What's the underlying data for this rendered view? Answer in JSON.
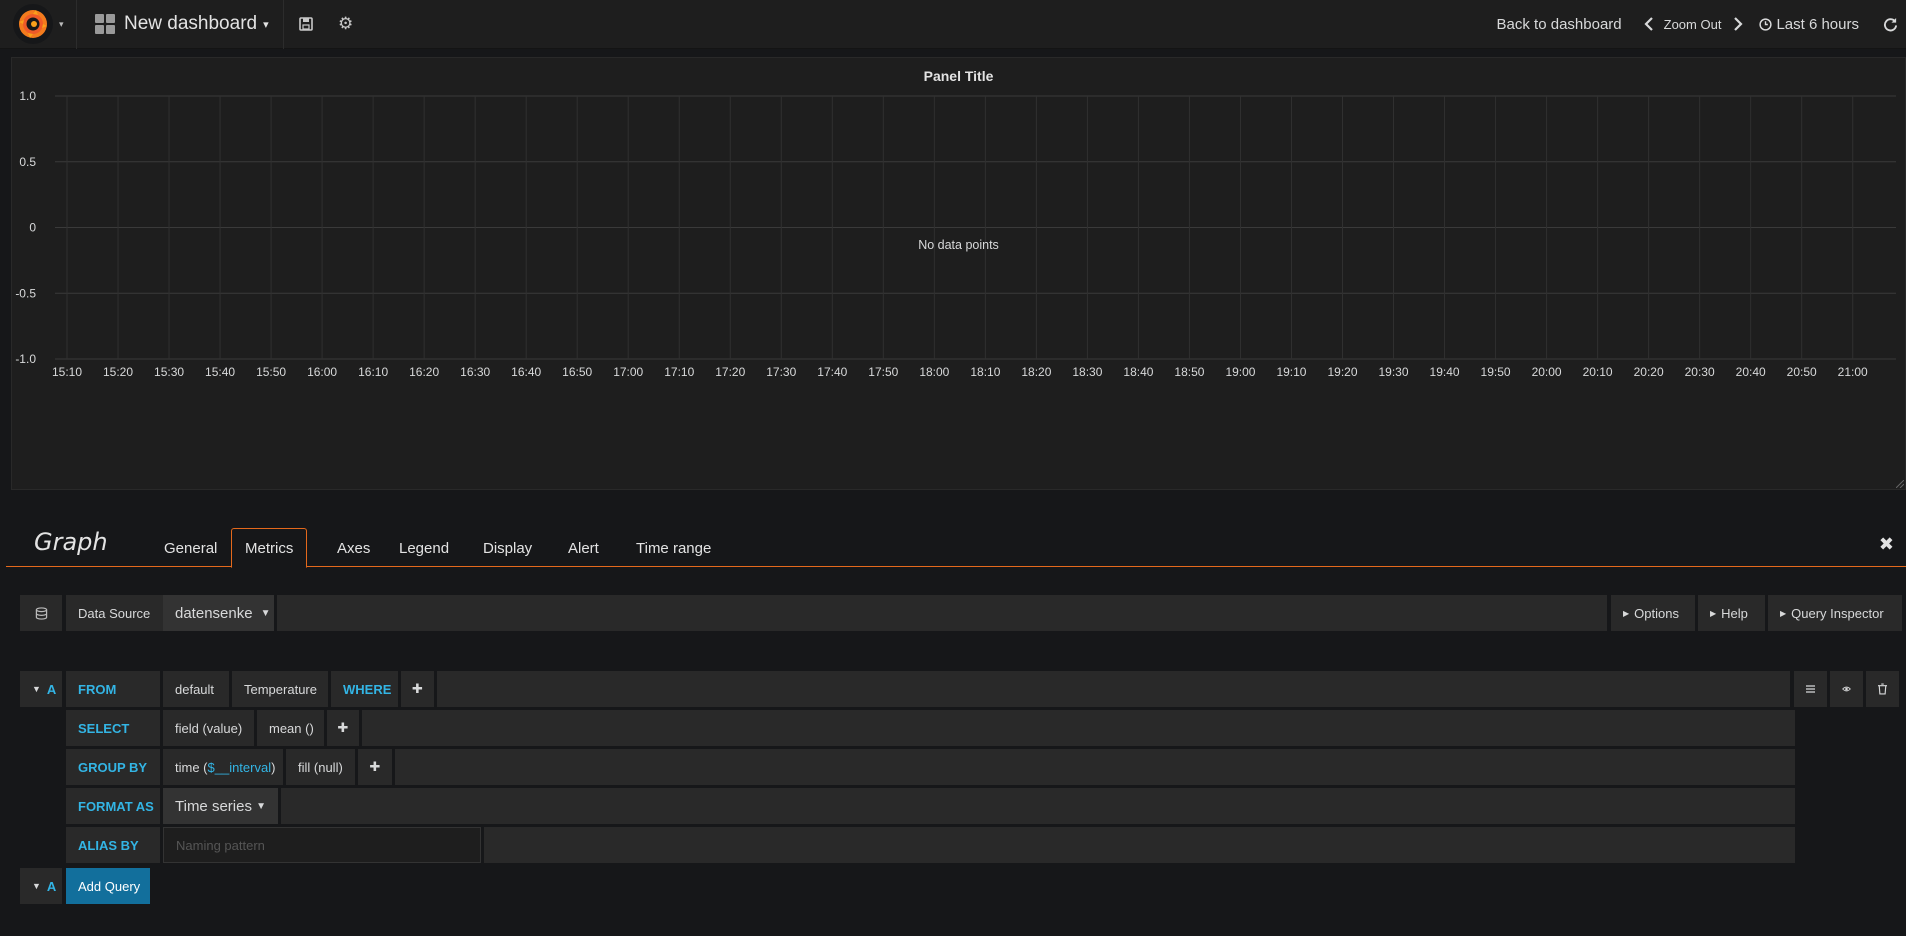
{
  "navbar": {
    "dashboard_title": "New dashboard",
    "back_label": "Back to dashboard",
    "zoom_label": "Zoom Out",
    "time_range": "Last 6 hours"
  },
  "panel": {
    "title": "Panel Title",
    "no_data": "No data points"
  },
  "chart_data": {
    "type": "line",
    "title": "Panel Title",
    "y_ticks": [
      "1.0",
      "0.5",
      "0",
      "-0.5",
      "-1.0"
    ],
    "ylim": [
      -1,
      1
    ],
    "x_ticks": [
      "15:10",
      "15:20",
      "15:30",
      "15:40",
      "15:50",
      "16:00",
      "16:10",
      "16:20",
      "16:30",
      "16:40",
      "16:50",
      "17:00",
      "17:10",
      "17:20",
      "17:30",
      "17:40",
      "17:50",
      "18:00",
      "18:10",
      "18:20",
      "18:30",
      "18:40",
      "18:50",
      "19:00",
      "19:10",
      "19:20",
      "19:30",
      "19:40",
      "19:50",
      "20:00",
      "20:10",
      "20:20",
      "20:30",
      "20:40",
      "20:50",
      "21:00"
    ],
    "series": [],
    "grid": true
  },
  "editor": {
    "title": "Graph",
    "tabs": [
      "General",
      "Metrics",
      "Axes",
      "Legend",
      "Display",
      "Alert",
      "Time range"
    ],
    "active_tab": "Metrics"
  },
  "datasource": {
    "label": "Data Source",
    "value": "datensenke",
    "options": "Options",
    "help": "Help",
    "inspector": "Query Inspector"
  },
  "query": {
    "ref": "A",
    "from_kw": "FROM",
    "policy": "default",
    "measurement": "Temperature",
    "where_kw": "WHERE",
    "select_kw": "SELECT",
    "field": "field (value)",
    "aggr": "mean ()",
    "groupby_kw": "GROUP BY",
    "time_prefix": "time (",
    "time_interval": "$__interval",
    "time_suffix": ")",
    "fill": "fill (null)",
    "format_kw": "FORMAT AS",
    "format_value": "Time series",
    "alias_kw": "ALIAS BY",
    "alias_placeholder": "Naming pattern",
    "add_query": "Add Query",
    "add_ref": "A"
  }
}
